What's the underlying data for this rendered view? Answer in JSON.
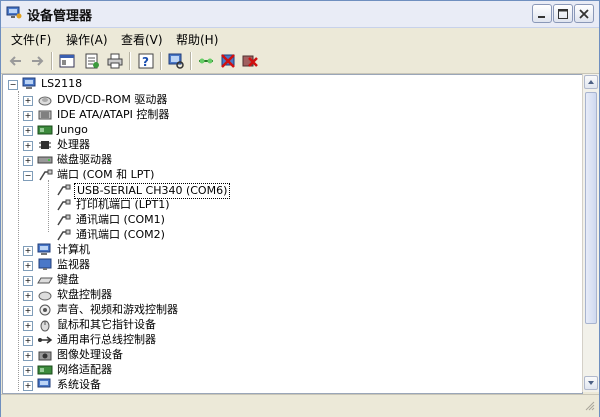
{
  "window": {
    "title": "设备管理器"
  },
  "menu": [
    "文件(F)",
    "操作(A)",
    "查看(V)",
    "帮助(H)"
  ],
  "toolbar": {
    "icons": [
      "back-icon",
      "forward-icon",
      "properties-icon",
      "update-driver-icon",
      "print-icon",
      "help-icon",
      "scan-hardware-icon",
      "network-icon",
      "disable-icon",
      "uninstall-icon"
    ]
  },
  "tree": {
    "root": "LS2118",
    "items": [
      {
        "label": "DVD/CD-ROM 驱动器",
        "icon": "dvd-drive-icon",
        "expanded": false
      },
      {
        "label": "IDE ATA/ATAPI 控制器",
        "icon": "ide-controller-icon",
        "expanded": false
      },
      {
        "label": "Jungo",
        "icon": "jungo-device-icon",
        "expanded": false
      },
      {
        "label": "处理器",
        "icon": "processor-icon",
        "expanded": false
      },
      {
        "label": "磁盘驱动器",
        "icon": "disk-drive-icon",
        "expanded": false
      },
      {
        "label": "端口 (COM 和 LPT)",
        "icon": "port-icon",
        "expanded": true,
        "children": [
          {
            "label": "USB-SERIAL CH340 (COM6)",
            "selected": true
          },
          {
            "label": "打印机端口 (LPT1)"
          },
          {
            "label": "通讯端口 (COM1)"
          },
          {
            "label": "通讯端口 (COM2)"
          }
        ]
      },
      {
        "label": "计算机",
        "icon": "computer-icon",
        "expanded": false
      },
      {
        "label": "监视器",
        "icon": "monitor-icon",
        "expanded": false
      },
      {
        "label": "键盘",
        "icon": "keyboard-icon",
        "expanded": false
      },
      {
        "label": "软盘控制器",
        "icon": "floppy-controller-icon",
        "expanded": false
      },
      {
        "label": "声音、视频和游戏控制器",
        "icon": "sound-icon",
        "expanded": false
      },
      {
        "label": "鼠标和其它指针设备",
        "icon": "mouse-icon",
        "expanded": false
      },
      {
        "label": "通用串行总线控制器",
        "icon": "usb-icon",
        "expanded": false
      },
      {
        "label": "图像处理设备",
        "icon": "imaging-icon",
        "expanded": false
      },
      {
        "label": "网络适配器",
        "icon": "network-adapter-icon",
        "expanded": false
      },
      {
        "label": "系统设备",
        "icon": "system-devices-icon",
        "expanded": false
      }
    ]
  },
  "colors": {
    "title_bg": "#e9ecf6",
    "chrome": "#ece9d8",
    "border": "#6f8fbf"
  }
}
